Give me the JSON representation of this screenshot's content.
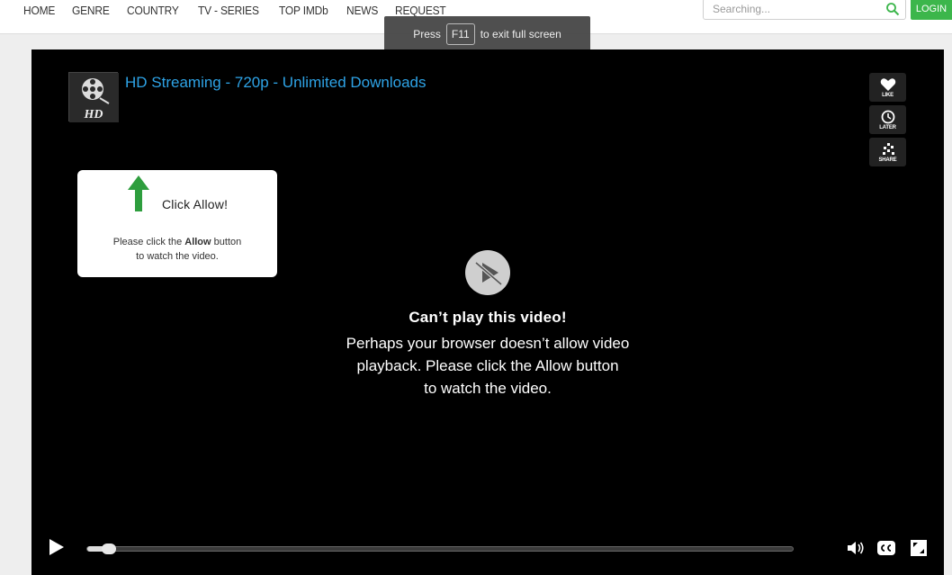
{
  "nav": {
    "items": [
      "HOME",
      "GENRE",
      "COUNTRY",
      "TV - SERIES",
      "TOP IMDb",
      "NEWS",
      "REQUEST"
    ]
  },
  "search": {
    "placeholder": "Searching..."
  },
  "login_label": "LOGIN",
  "fullscreen_toast": {
    "prefix": "Press",
    "key": "F11",
    "suffix": "to exit full screen"
  },
  "player": {
    "thumb_label": "HD",
    "title": "HD Streaming - 720p - Unlimited Downloads",
    "actions": [
      {
        "label": "LIKE",
        "icon": "heart-icon"
      },
      {
        "label": "LATER",
        "icon": "clock-icon"
      },
      {
        "label": "SHARE",
        "icon": "share-icon"
      }
    ],
    "allow_box": {
      "heading": "Click Allow!",
      "line1_pre": "Please click the ",
      "line1_bold": "Allow",
      "line1_post": " button",
      "line2": "to watch the video."
    },
    "message": {
      "heading": "Can’t play this video!",
      "line1": "Perhaps your browser doesn’t allow video",
      "line2": "playback. Please click the Allow button",
      "line3": "to watch the video."
    },
    "progress": 0.02
  },
  "colors": {
    "accent": "#2ea3e6",
    "login_green": "#3cb64b",
    "arrow_green": "#2e9e3e"
  }
}
